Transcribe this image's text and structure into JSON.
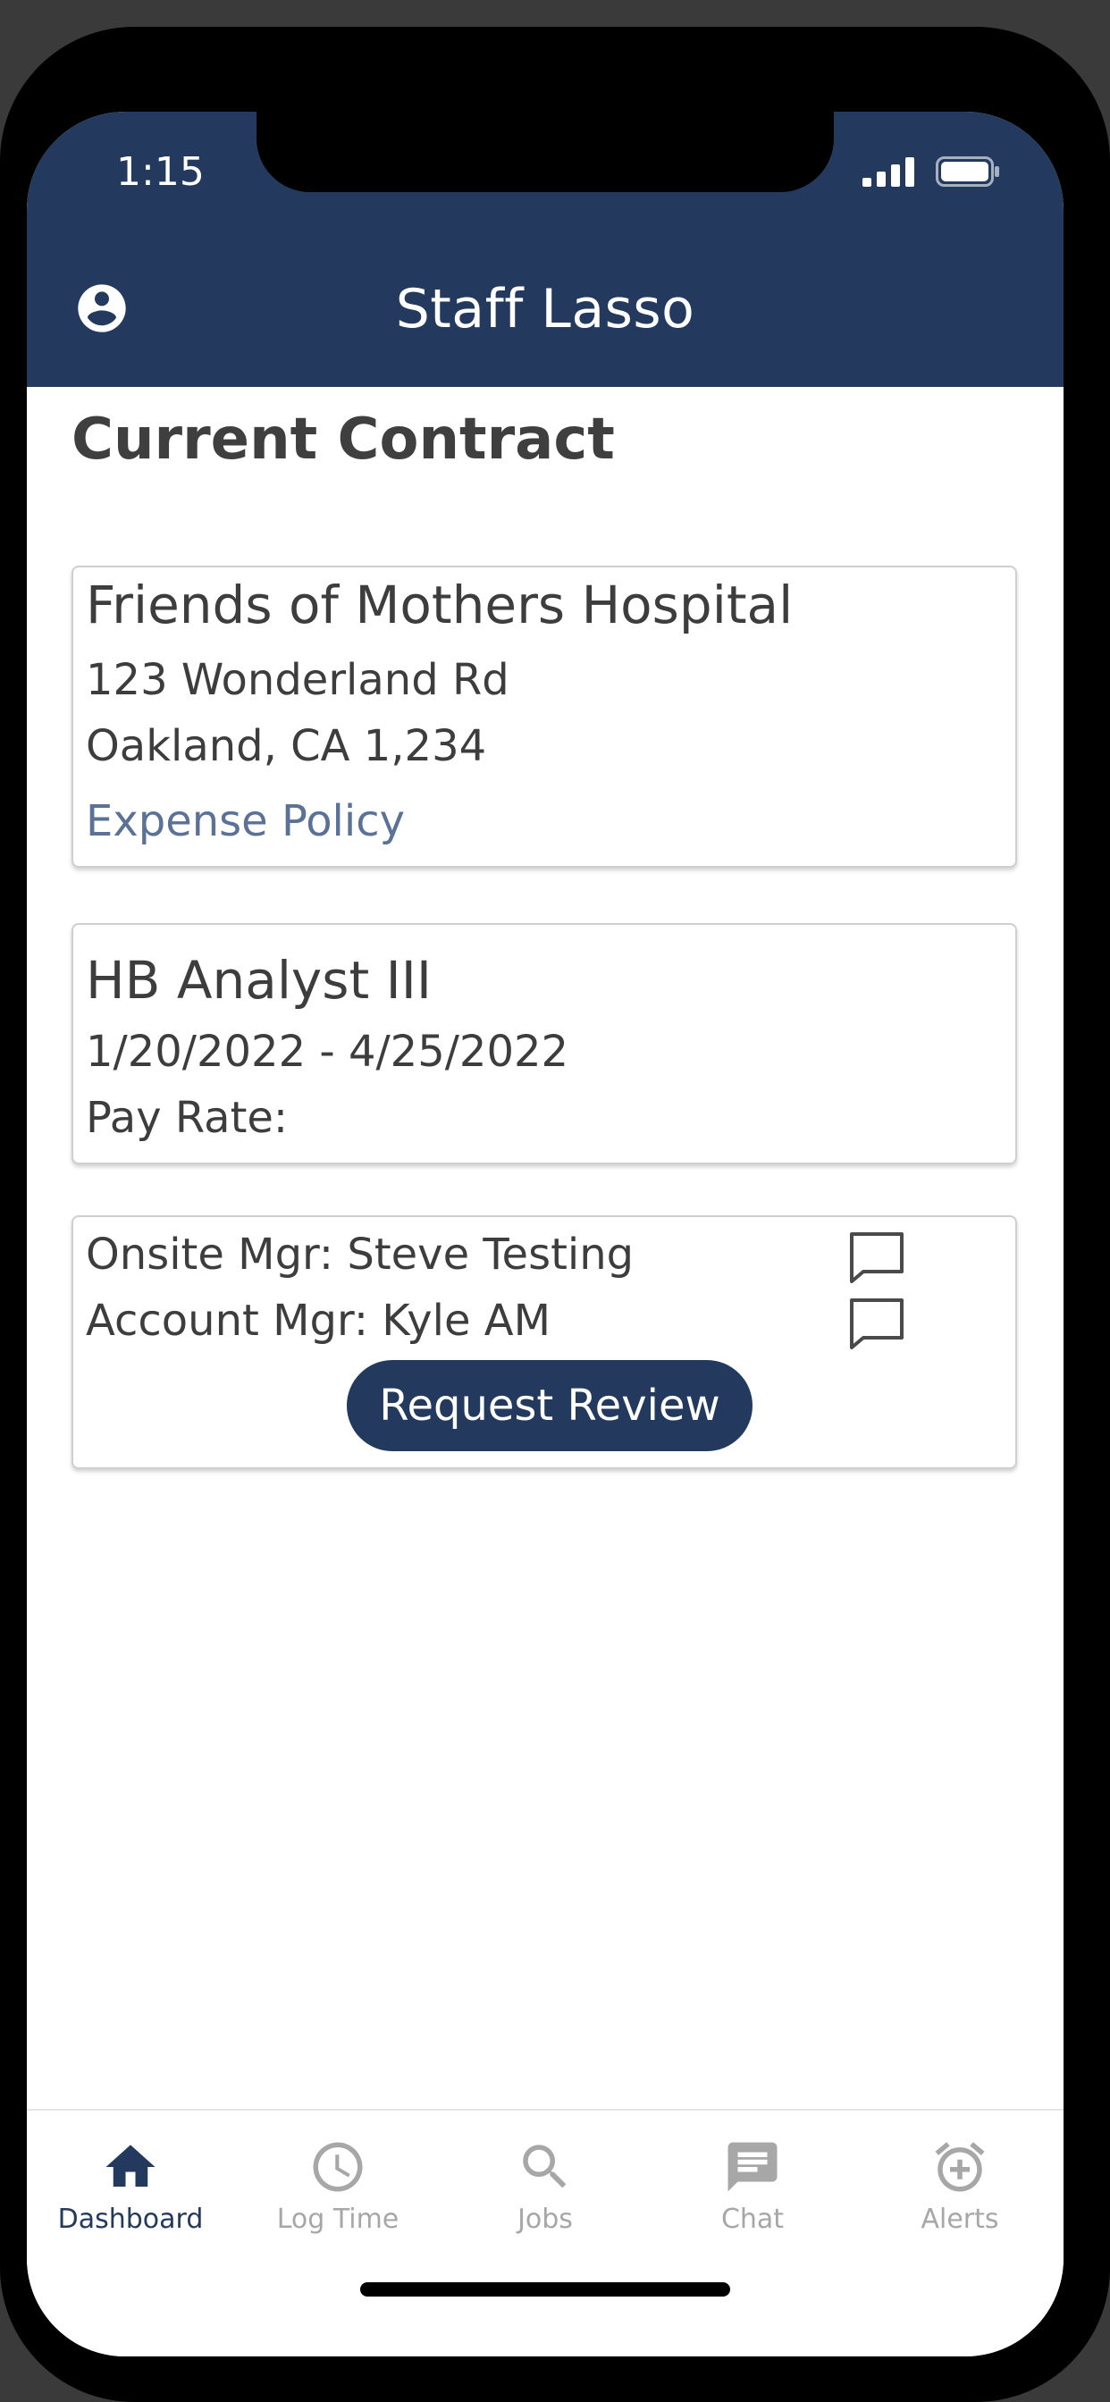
{
  "status_bar": {
    "time": "1:15"
  },
  "header": {
    "title": "Staff Lasso"
  },
  "page": {
    "title": "Current Contract"
  },
  "facility_card": {
    "name": "Friends of Mothers Hospital",
    "address_line1": "123 Wonderland Rd",
    "address_line2": "Oakland, CA 1,234",
    "expense_policy_link": "Expense Policy"
  },
  "job_card": {
    "position": "HB Analyst III",
    "date_range": "1/20/2022 - 4/25/2022",
    "pay_rate_label": "Pay Rate:"
  },
  "managers_card": {
    "onsite_manager": "Onsite Mgr: Steve Testing",
    "account_manager": "Account Mgr: Kyle AM",
    "request_review_label": "Request Review"
  },
  "tabbar": {
    "tabs": [
      {
        "label": "Dashboard",
        "icon": "home-icon",
        "active": true
      },
      {
        "label": "Log Time",
        "icon": "clock-icon",
        "active": false
      },
      {
        "label": "Jobs",
        "icon": "search-icon",
        "active": false
      },
      {
        "label": "Chat",
        "icon": "chat-icon",
        "active": false
      },
      {
        "label": "Alerts",
        "icon": "alarm-add-icon",
        "active": false
      }
    ]
  },
  "colors": {
    "brand": "#233a5e",
    "link": "#5b7196",
    "inactive_tab": "#a7a7a7",
    "text": "#3d3d3d"
  }
}
